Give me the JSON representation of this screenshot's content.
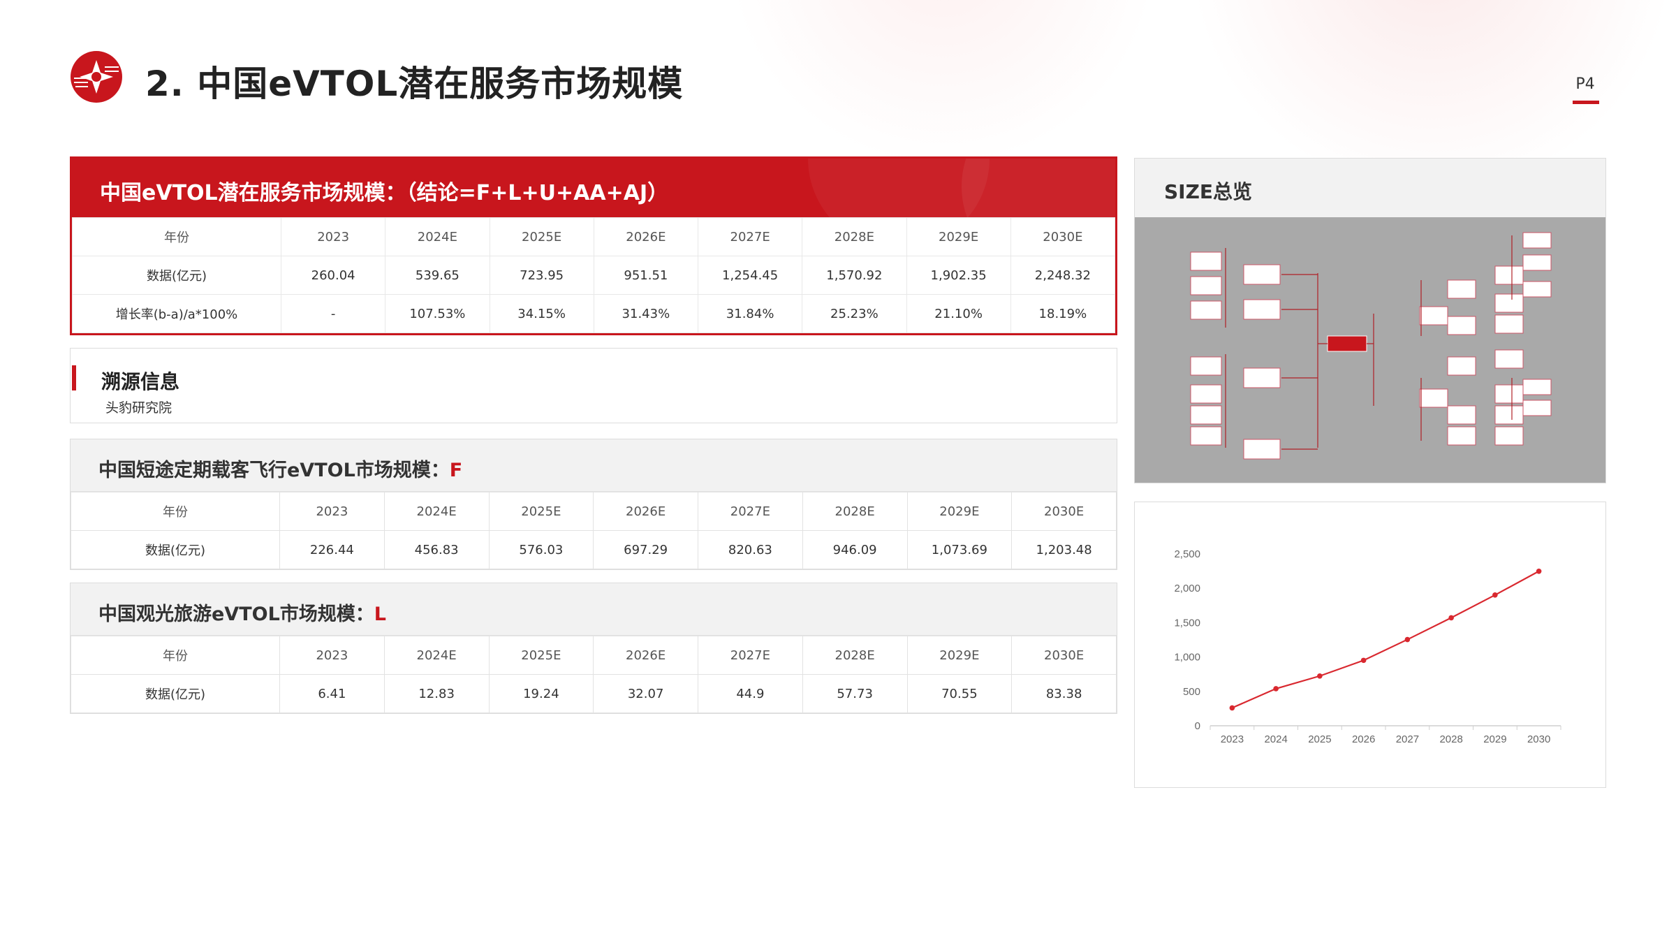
{
  "header": {
    "title": "2. 中国eVTOL潜在服务市场规模",
    "page_number": "P4"
  },
  "colors": {
    "accent": "#c8161d",
    "line": "#d9282f"
  },
  "main_table": {
    "title": "中国eVTOL潜在服务市场规模：（结论=F+L+U+AA+AJ）",
    "rows": [
      [
        "年份",
        "2023",
        "2024E",
        "2025E",
        "2026E",
        "2027E",
        "2028E",
        "2029E",
        "2030E"
      ],
      [
        "数据(亿元)",
        "260.04",
        "539.65",
        "723.95",
        "951.51",
        "1,254.45",
        "1,570.92",
        "1,902.35",
        "2,248.32"
      ],
      [
        "增长率(b-a)/a*100%",
        "-",
        "107.53%",
        "34.15%",
        "31.43%",
        "31.84%",
        "25.23%",
        "21.10%",
        "18.19%"
      ]
    ]
  },
  "source": {
    "title": "溯源信息",
    "text": "头豹研究院"
  },
  "table_f": {
    "title": "中国短途定期载客飞行eVTOL市场规模：",
    "tag": "F",
    "rows": [
      [
        "年份",
        "2023",
        "2024E",
        "2025E",
        "2026E",
        "2027E",
        "2028E",
        "2029E",
        "2030E"
      ],
      [
        "数据(亿元)",
        "226.44",
        "456.83",
        "576.03",
        "697.29",
        "820.63",
        "946.09",
        "1,073.69",
        "1,203.48"
      ]
    ]
  },
  "table_l": {
    "title": "中国观光旅游eVTOL市场规模：",
    "tag": "L",
    "rows": [
      [
        "年份",
        "2023",
        "2024E",
        "2025E",
        "2026E",
        "2027E",
        "2028E",
        "2029E",
        "2030E"
      ],
      [
        "数据(亿元)",
        "6.41",
        "12.83",
        "19.24",
        "32.07",
        "44.9",
        "57.73",
        "70.55",
        "83.38"
      ]
    ]
  },
  "size_panel": {
    "title": "SIZE总览"
  },
  "chart_data": {
    "type": "line",
    "categories": [
      "2023",
      "2024",
      "2025",
      "2026",
      "2027",
      "2028",
      "2029",
      "2030"
    ],
    "series": [
      {
        "values": [
          260.04,
          539.65,
          723.95,
          951.51,
          1254.45,
          1570.92,
          1902.35,
          2248.32
        ]
      }
    ],
    "yticks": [
      "0",
      "500",
      "1,000",
      "1,500",
      "2,000",
      "2,500"
    ],
    "ylim": [
      0,
      2500
    ],
    "grid": false
  }
}
